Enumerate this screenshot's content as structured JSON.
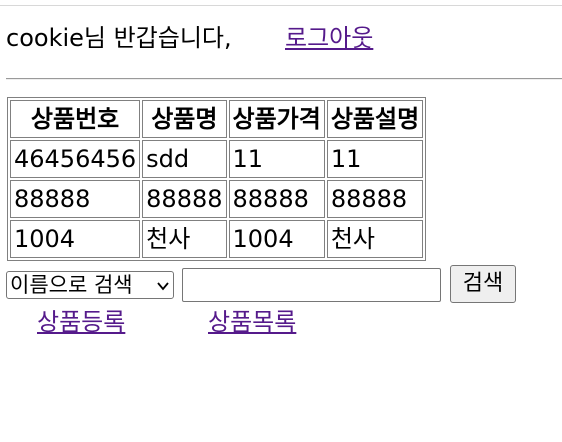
{
  "header": {
    "greeting": "cookie님 반갑습니다,",
    "logout_label": "로그아웃"
  },
  "table": {
    "headers": [
      "상품번호",
      "상품명",
      "상품가격",
      "상품설명"
    ],
    "rows": [
      [
        "46456456",
        "sdd",
        "11",
        "11"
      ],
      [
        "88888",
        "88888",
        "88888",
        "88888"
      ],
      [
        "1004",
        "천사",
        "1004",
        "천사"
      ]
    ]
  },
  "search": {
    "select_value": "이름으로 검색",
    "input_value": "",
    "button_label": "검색"
  },
  "links": {
    "register": "상품등록",
    "list": "상품목록"
  },
  "colors": {
    "link": "#551a8b",
    "border": "#808080"
  }
}
